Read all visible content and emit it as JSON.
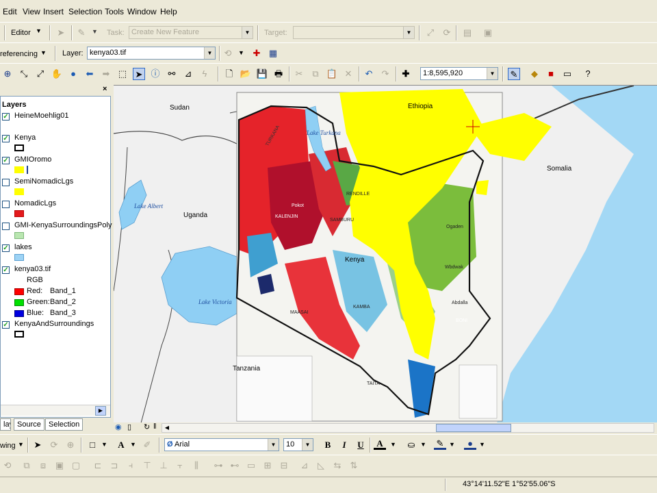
{
  "menu": {
    "items": [
      "Edit",
      "View",
      "Insert",
      "Selection",
      "Tools",
      "Window",
      "Help"
    ]
  },
  "editor_toolbar": {
    "editor_label": "Editor",
    "task_label": "Task:",
    "task_value": "Create New Feature",
    "target_label": "Target:",
    "target_value": ""
  },
  "georef_toolbar": {
    "georef_label": "referencing",
    "layer_label": "Layer:",
    "layer_value": "kenya03.tif"
  },
  "standard_toolbar": {
    "scale_value": "1:8,595,920"
  },
  "toc": {
    "title": "Layers",
    "layers": [
      {
        "name": "HeineMoehlig01",
        "checked": true
      },
      {
        "name": "Kenya",
        "checked": true,
        "swatch": "#ffffff"
      },
      {
        "name": "GMIOromo",
        "checked": true,
        "swatch": "#ffff00"
      },
      {
        "name": "SemiNomadicLgs",
        "checked": false,
        "swatch": "#ffff00"
      },
      {
        "name": "NomadicLgs",
        "checked": false,
        "swatch": "#e31a1c"
      },
      {
        "name": "GMI-KenyaSurroundingsPoly",
        "checked": false,
        "swatch": "#b9e6b0"
      },
      {
        "name": "lakes",
        "checked": true,
        "swatch": "#9dd3f5"
      },
      {
        "name": "kenya03.tif",
        "checked": true
      },
      {
        "name": "KenyaAndSurroundings",
        "checked": true,
        "swatch": "#ffffff"
      }
    ],
    "raster": {
      "rgb_label": "RGB",
      "bands": [
        {
          "label": "Red:",
          "band": "Band_1",
          "color": "#ff0000"
        },
        {
          "label": "Green:",
          "band": "Band_2",
          "color": "#00e000"
        },
        {
          "label": "Blue:",
          "band": "Band_3",
          "color": "#0000e0"
        }
      ]
    },
    "tabs": [
      "lay",
      "Source",
      "Selection"
    ]
  },
  "map": {
    "countries": [
      "Sudan",
      "Ethiopia",
      "Somalia",
      "Uganda",
      "Tanzania",
      "Kenya"
    ],
    "lakes": [
      "Lake Turkana",
      "Lake Albert",
      "Lake Victoria"
    ],
    "regions": [
      "TURKANA",
      "RENDILLE",
      "SAMBURU",
      "KALENJIN",
      "MAASAI",
      "KAMBA",
      "BONI",
      "TAITA",
      "Ogaden",
      "Abdalla",
      "Pokot",
      "Wbdwak"
    ]
  },
  "drawing_toolbar": {
    "drawing_label": "wing",
    "font_name": "Arial",
    "font_size": "10",
    "bold": "B",
    "italic": "I",
    "underline": "U",
    "font_color_label": "A"
  },
  "status": {
    "coordinates": "43°14'11.52\"E  1°52'55.06\"S"
  }
}
